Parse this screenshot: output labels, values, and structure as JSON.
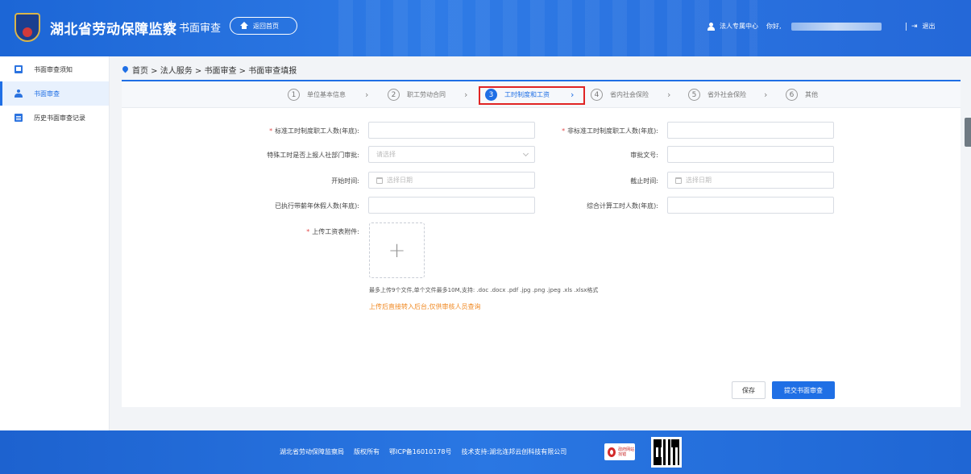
{
  "header": {
    "site_title": "湖北省劳动保障监察",
    "separator": "|",
    "module_title": "书面审查",
    "home_button": "返回首页",
    "user_center": "法人专属中心",
    "greeting": "你好,",
    "divider": "|",
    "logout": "退出"
  },
  "sidebar": {
    "items": [
      {
        "label": "书面审查须知",
        "icon": "book-icon"
      },
      {
        "label": "书面审查",
        "icon": "person-icon"
      },
      {
        "label": "历史书面审查记录",
        "icon": "document-icon"
      }
    ]
  },
  "breadcrumb": "首页 > 法人服务 > 书面审查 > 书面审查填报",
  "steps": [
    {
      "num": "1",
      "label": "单位基本信息"
    },
    {
      "num": "2",
      "label": "职工劳动合同"
    },
    {
      "num": "3",
      "label": "工时制度和工资"
    },
    {
      "num": "4",
      "label": "省内社会保险"
    },
    {
      "num": "5",
      "label": "省外社会保险"
    },
    {
      "num": "6",
      "label": "其他"
    }
  ],
  "form": {
    "std_workers_label": "标准工时制度职工人数(年底):",
    "nonstd_workers_label": "非标准工时制度职工人数(年底):",
    "special_approval_label": "特殊工时是否上报人社部门审批:",
    "special_approval_placeholder": "请选择",
    "approval_no_label": "审批文号:",
    "start_time_label": "开始时间:",
    "start_time_placeholder": "选择日期",
    "end_time_label": "截止时间:",
    "end_time_placeholder": "选择日期",
    "paid_leave_label": "已执行带薪年休假人数(年底):",
    "comprehensive_label": "综合计算工时人数(年底):",
    "upload_label": "上传工资表附件:",
    "upload_plus": "+",
    "upload_hint": "最多上传9个文件,单个文件最多10M,支持: .doc .docx .pdf .jpg .png .jpeg .xls .xlsx格式",
    "upload_warn": "上传后直接转入后台,仅供审核人员查询"
  },
  "buttons": {
    "save": "保存",
    "submit": "提交书面审查"
  },
  "footer": {
    "org": "湖北省劳动保障监察局",
    "rights": "版权所有",
    "icp": "鄂ICP备16010178号",
    "support": "技术支持:湖北连邦云创科技有限公司",
    "badge": "政府网站找错"
  },
  "colors": {
    "primary": "#1f6fe5",
    "highlight_border": "#e02424",
    "warning": "#f08a24"
  }
}
